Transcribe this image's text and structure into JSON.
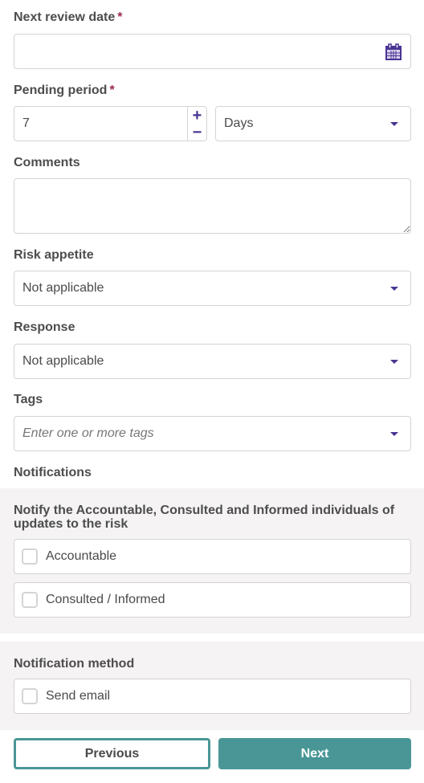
{
  "colors": {
    "accent": "#4a3592",
    "required": "#9b2758",
    "primary_button": "#4a9696",
    "panel_bg": "#f5f3f3",
    "border": "#d4d4d4"
  },
  "next_review_date": {
    "label": "Next review date",
    "required_mark": "*",
    "value": "",
    "icon": "calendar-icon"
  },
  "pending_period": {
    "label": "Pending period",
    "required_mark": "*",
    "value": "7",
    "increment_symbol": "+",
    "decrement_symbol": "−",
    "unit": "Days"
  },
  "comments": {
    "label": "Comments",
    "value": ""
  },
  "risk_appetite": {
    "label": "Risk appetite",
    "value": "Not applicable"
  },
  "response": {
    "label": "Response",
    "value": "Not applicable"
  },
  "tags": {
    "label": "Tags",
    "placeholder": "Enter one or more tags"
  },
  "notifications": {
    "label": "Notifications",
    "notify_title": "Notify the Accountable, Consulted and Informed individuals of updates to the risk",
    "options": [
      {
        "label": "Accountable",
        "checked": false
      },
      {
        "label": "Consulted / Informed",
        "checked": false
      }
    ],
    "method_title": "Notification method",
    "method_options": [
      {
        "label": "Send email",
        "checked": false
      }
    ]
  },
  "footer": {
    "previous_label": "Previous",
    "next_label": "Next"
  }
}
